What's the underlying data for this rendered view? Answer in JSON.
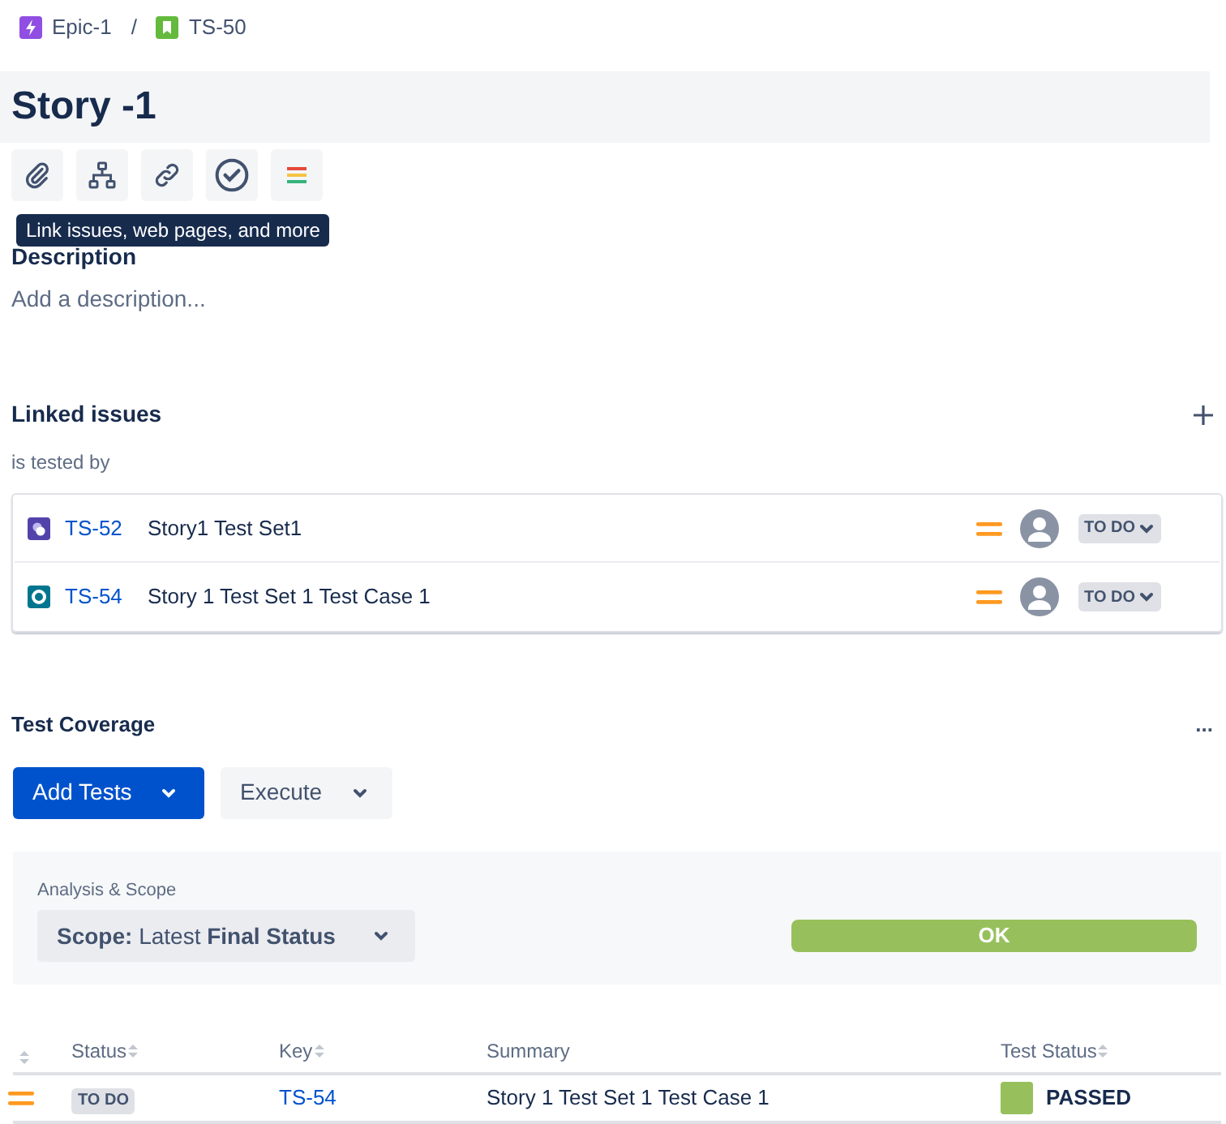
{
  "breadcrumbs": [
    {
      "kind": "epic",
      "label": "Epic-1"
    },
    {
      "kind": "story",
      "label": "TS-50"
    }
  ],
  "breadcrumb_separator": "/",
  "title": "Story -1",
  "toolbar": [
    {
      "kind": "attach"
    },
    {
      "kind": "hierarchy"
    },
    {
      "kind": "link"
    },
    {
      "kind": "check"
    },
    {
      "kind": "colors"
    }
  ],
  "tooltip": "Link issues, web pages, and more",
  "description": {
    "heading": "Description",
    "placeholder": "Add a description..."
  },
  "linked_issues": {
    "heading": "Linked issues",
    "relation": "is tested by",
    "items": [
      {
        "kind": "test-set",
        "key": "TS-52",
        "summary": "Story1 Test Set1",
        "status": "TO DO"
      },
      {
        "kind": "test",
        "key": "TS-54",
        "summary": "Story 1 Test Set 1 Test Case 1",
        "status": "TO DO"
      }
    ]
  },
  "test_coverage": {
    "heading": "Test Coverage",
    "more": "...",
    "buttons": [
      {
        "kind": "primary",
        "label": "Add Tests"
      },
      {
        "kind": "secondary",
        "label": "Execute"
      }
    ],
    "analysis": {
      "label": "Analysis & Scope",
      "scope": "**Scope:** Latest **Final Status**",
      "result": "OK",
      "level": 1
    },
    "table": {
      "columns": [
        {
          "sortable": true
        },
        {
          "label": "Status",
          "sortable": true
        },
        {
          "label": "Key",
          "sortable": true
        },
        {
          "label": "Summary",
          "sortable": false
        },
        {
          "label": "Test Status",
          "sortable": true
        }
      ],
      "rows": [
        {
          "status": "TO DO",
          "key": "TS-54",
          "summary": "Story 1 Test Set 1 Test Case 1",
          "test_status": "PASSED"
        }
      ]
    }
  }
}
